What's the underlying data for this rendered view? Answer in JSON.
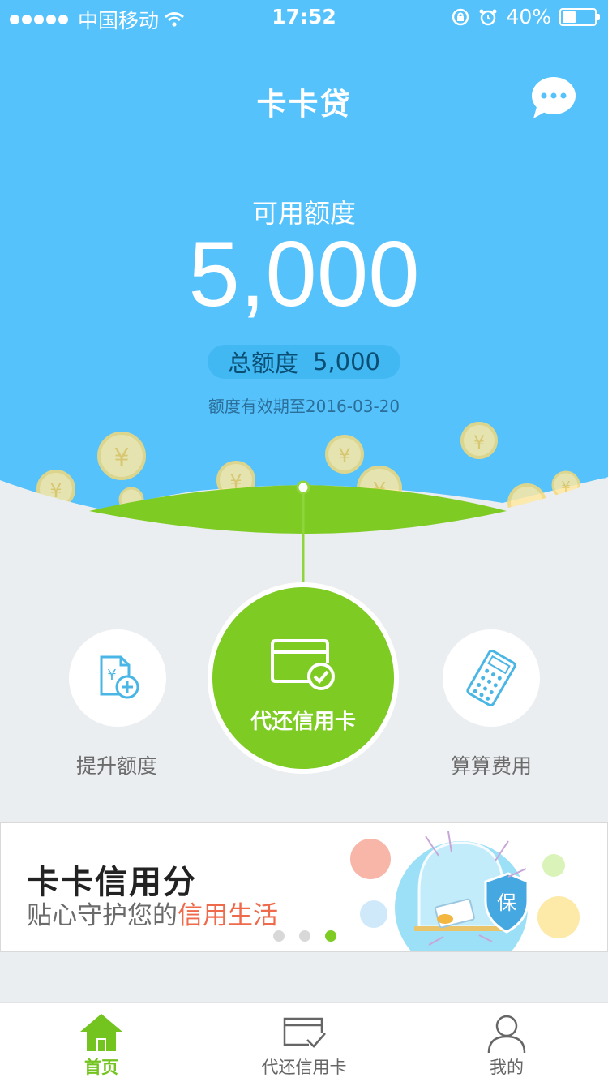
{
  "status_bar": {
    "carrier": "中国移动",
    "time": "17:52",
    "battery": "40%"
  },
  "header": {
    "title": "卡卡贷",
    "chat_icon": "chat-bubble-icon"
  },
  "credit": {
    "available_label": "可用额度",
    "available_amount": "5,000",
    "total_label": "总额度",
    "total_amount": "5,000",
    "validity": "额度有效期至2016-03-20"
  },
  "actions": {
    "raise_limit": {
      "label": "提升额度",
      "icon": "document-yen-plus-icon"
    },
    "repay_card": {
      "label": "代还信用卡",
      "icon": "credit-card-check-icon"
    },
    "calc_fee": {
      "label": "算算费用",
      "icon": "calculator-icon"
    }
  },
  "banner": {
    "title": "卡卡信用分",
    "subtitle_plain": "贴心守护您的",
    "subtitle_highlight": "信用生活",
    "shield_char": "保",
    "active_slide": 3,
    "slide_count": 3
  },
  "tab_bar": {
    "tabs": [
      {
        "label": "首页",
        "icon": "home-icon",
        "active": true
      },
      {
        "label": "代还信用卡",
        "icon": "card-check-icon",
        "active": false
      },
      {
        "label": "我的",
        "icon": "person-icon",
        "active": false
      }
    ]
  },
  "colors": {
    "sky": "#55c2fb",
    "green": "#7ecb23",
    "highlight": "#ef6a4a",
    "background": "#ebeef0"
  }
}
